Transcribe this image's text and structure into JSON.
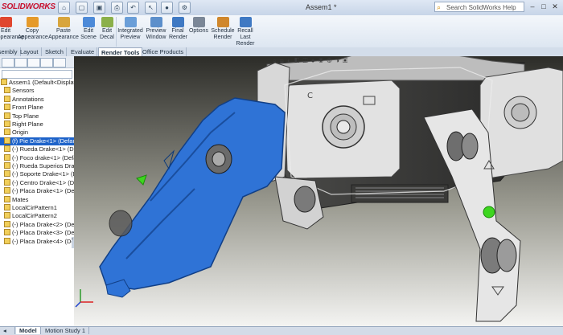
{
  "titlebar": {
    "logo": "SOLIDWORKS",
    "document_title": "Assem1 *",
    "help_placeholder": "Search SolidWorks Help",
    "window_buttons": [
      "–",
      "□",
      "✕"
    ]
  },
  "ribbon": {
    "buttons": [
      {
        "label": "Edit Appearance",
        "icon": "appearance-icon",
        "color": "#e0462e"
      },
      {
        "label": "Copy Appearance",
        "icon": "copy-appearance-icon",
        "color": "#e59a2a"
      },
      {
        "label": "Paste Appearance",
        "icon": "paste-appearance-icon",
        "color": "#d8a53c"
      },
      {
        "label": "Edit Scene",
        "icon": "scene-icon",
        "color": "#4d8ad8"
      },
      {
        "label": "Edit Decal",
        "icon": "decal-icon",
        "color": "#8bb04a"
      },
      {
        "label": "Integrated Preview",
        "icon": "integrated-preview-icon",
        "color": "#6a9ed8"
      },
      {
        "label": "Preview Window",
        "icon": "preview-window-icon",
        "color": "#5c8fcb"
      },
      {
        "label": "Final Render",
        "icon": "final-render-icon",
        "color": "#3f79c3"
      },
      {
        "label": "Options",
        "icon": "options-icon",
        "color": "#7b8797"
      },
      {
        "label": "Schedule Render",
        "icon": "schedule-render-icon",
        "color": "#d0872c"
      },
      {
        "label": "Recall Last Render",
        "icon": "recall-render-icon",
        "color": "#3f79c3"
      }
    ]
  },
  "tabs": [
    "Assembly",
    "Layout",
    "Sketch",
    "Evaluate",
    "Render Tools",
    "Office Products"
  ],
  "active_tab": "Render Tools",
  "feature_tree": {
    "items": [
      {
        "label": "Assem1  (Default<Display State"
      },
      {
        "label": "Sensors"
      },
      {
        "label": "Annotations"
      },
      {
        "label": "Front Plane"
      },
      {
        "label": "Top Plane"
      },
      {
        "label": "Right Plane"
      },
      {
        "label": "Origin"
      },
      {
        "label": "(f) Pie Drake<1> (Default<<"
      },
      {
        "label": "(-) Rueda Drake<1> (Default<"
      },
      {
        "label": "(-) Foco drake<1> (Default<"
      },
      {
        "label": "(-) Rueda Superios Drake<1>"
      },
      {
        "label": "(-) Soporte Drake<1> (Defaul"
      },
      {
        "label": "(-) Centro Drake<1> (Default<"
      },
      {
        "label": "(-) Placa Drake<1> (Default<"
      },
      {
        "label": "Mates"
      },
      {
        "label": "LocalCirPattern1"
      },
      {
        "label": "LocalCirPattern2"
      },
      {
        "label": "(-) Placa Drake<2> (Def"
      },
      {
        "label": "(-) Placa Drake<3> (Def"
      },
      {
        "label": "(-) Placa Drake<4> (Def"
      }
    ],
    "selected_index": 7
  },
  "bottom_tabs": [
    "Model",
    "Motion Study 1"
  ],
  "colors": {
    "selection": "#1e63c9",
    "model_gray": "#d7d7d7",
    "model_blue": "#2f73d6",
    "highlight_green": "#3dd61f"
  }
}
